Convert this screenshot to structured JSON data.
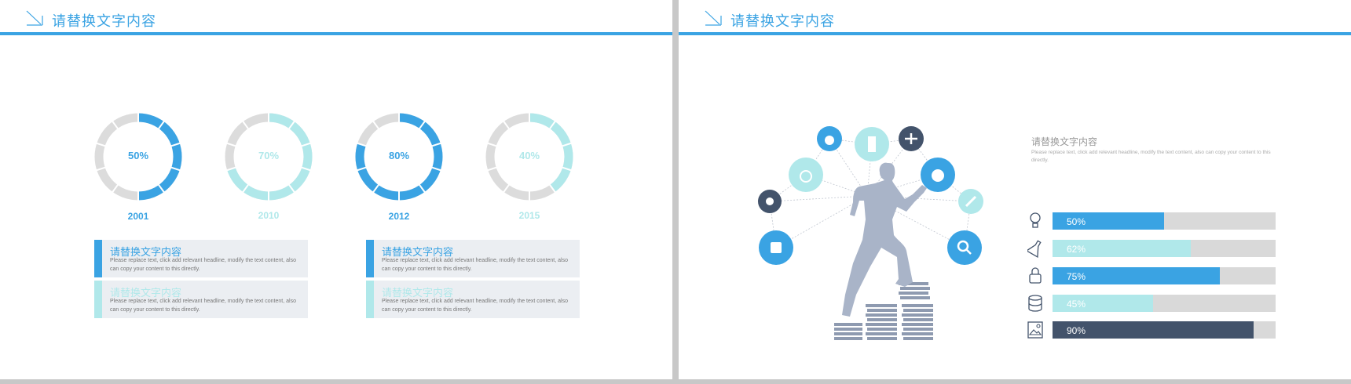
{
  "left_slide": {
    "title": "请替换文字内容",
    "donuts": [
      {
        "percent": "50%",
        "value": 0.5,
        "year": "2001",
        "color": "#3aa3e3"
      },
      {
        "percent": "70%",
        "value": 0.7,
        "year": "2010",
        "color": "#b0e8ea"
      },
      {
        "percent": "80%",
        "value": 0.8,
        "year": "2012",
        "color": "#3aa3e3"
      },
      {
        "percent": "40%",
        "value": 0.4,
        "year": "2015",
        "color": "#b0e8ea"
      }
    ],
    "cards": [
      {
        "title": "请替换文字内容",
        "body": "Please replace text, click add relevant headline, modify the text content, also can copy your content to this directly.",
        "color": "#3aa3e3"
      },
      {
        "title": "请替换文字内容",
        "body": "Please replace text, click add relevant headline, modify the text content, also can copy your content to this directly.",
        "color": "#b0e8ea"
      },
      {
        "title": "请替换文字内容",
        "body": "Please replace text, click add relevant headline, modify the text content, also can copy your content to this directly.",
        "color": "#3aa3e3"
      },
      {
        "title": "请替换文字内容",
        "body": "Please replace text, click add relevant headline, modify the text content, also can copy your content to this directly.",
        "color": "#b0e8ea"
      }
    ]
  },
  "right_slide": {
    "title": "请替换文字内容",
    "panel_title": "请替换文字内容",
    "panel_body": "Please replace text, click add relevant headline, modify the text content, also can copy your content to this directly.",
    "bars": [
      {
        "label": "50%",
        "value": 0.5,
        "icon": "lightbulb-icon",
        "color": "#3aa3e3"
      },
      {
        "label": "62%",
        "value": 0.62,
        "icon": "flask-icon",
        "color": "#b0e8ea"
      },
      {
        "label": "75%",
        "value": 0.75,
        "icon": "lock-icon",
        "color": "#3aa3e3"
      },
      {
        "label": "45%",
        "value": 0.45,
        "icon": "database-icon",
        "color": "#b0e8ea"
      },
      {
        "label": "90%",
        "value": 0.9,
        "icon": "image-icon",
        "color": "#43536b"
      }
    ]
  },
  "colors": {
    "accent": "#3aa3e3",
    "light": "#b0e8ea",
    "dark": "#43536b",
    "track": "#d9d9d9",
    "figure": "#a9b4c8"
  }
}
